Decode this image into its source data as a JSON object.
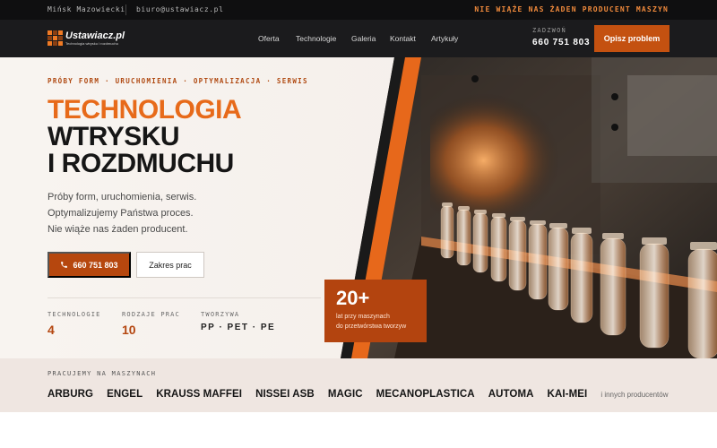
{
  "topbar": {
    "location": "Mińsk Mazowiecki",
    "email": "biuro@ustawiacz.pl",
    "claim": "NIE WIĄŻE NAS ŻADEN PRODUCENT MASZYN"
  },
  "nav": {
    "logo_name": "Ustawiacz.pl",
    "logo_tagline": "Technologia wtrysku i rozdmuchu",
    "menu": [
      "Oferta",
      "Technologie",
      "Galeria",
      "Kontakt",
      "Artykuły"
    ],
    "call_label": "ZADZWOŃ",
    "call_number": "660 751 803",
    "cta_label": "Opisz problem"
  },
  "hero": {
    "kicker": "PRÓBY FORM · URUCHOMIENIA · OPTYMALIZACJA · SERWIS",
    "title_line1": "TECHNOLOGIA",
    "title_line2": "WTRYSKU",
    "title_line3": "I ROZDMUCHU",
    "lead": [
      "Próby form, uruchomienia, serwis.",
      "Optymalizujemy Państwa proces.",
      "Nie wiąże nas żaden producent."
    ],
    "phone_button": "660 751 803",
    "scope_button": "Zakres prac",
    "stats": [
      {
        "label": "TECHNOLOGIE",
        "value": "4"
      },
      {
        "label": "RODZAJE PRAC",
        "value": "10"
      },
      {
        "label": "TWORZYWA",
        "value": "PP · PET · PE"
      }
    ],
    "badge_big": "20+",
    "badge_line1": "lat przy maszynach",
    "badge_line2": "do przetwórstwa tworzyw"
  },
  "machines": {
    "label": "PRACUJEMY NA MASZYNACH",
    "brands": [
      "ARBURG",
      "ENGEL",
      "KRAUSS MAFFEI",
      "NISSEI ASB",
      "MAGIC",
      "MECANOPLASTICA",
      "AUTOMA",
      "KAI-MEI"
    ],
    "more": "i innych producentów"
  },
  "colors": {
    "accent": "#e76a1a",
    "accent_dark": "#b4460f",
    "dark_bg": "#1b1b1d"
  }
}
